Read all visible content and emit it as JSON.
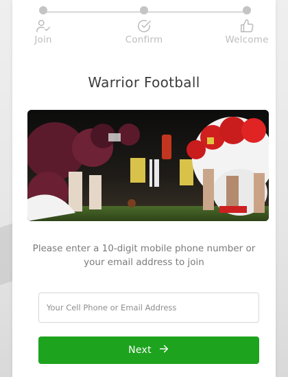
{
  "stepper": {
    "steps": [
      {
        "label": "Join",
        "icon": "user-check-icon"
      },
      {
        "label": "Confirm",
        "icon": "check-circle-icon"
      },
      {
        "label": "Welcome",
        "icon": "thumbs-up-icon"
      }
    ]
  },
  "page": {
    "title": "Warrior Football",
    "hero_image": "football-line-of-scrimmage-photo",
    "prompt": "Please enter a 10-digit mobile phone number or your email address to join"
  },
  "form": {
    "contact_placeholder": "Your Cell Phone or Email Address",
    "contact_value": ""
  },
  "actions": {
    "next_label": "Next",
    "next_icon": "arrow-right-icon"
  },
  "colors": {
    "primary": "#1ea31e",
    "step_inactive": "#c4c4c4",
    "text_title": "#3b3b3b",
    "text_muted": "#7a7a7a"
  }
}
